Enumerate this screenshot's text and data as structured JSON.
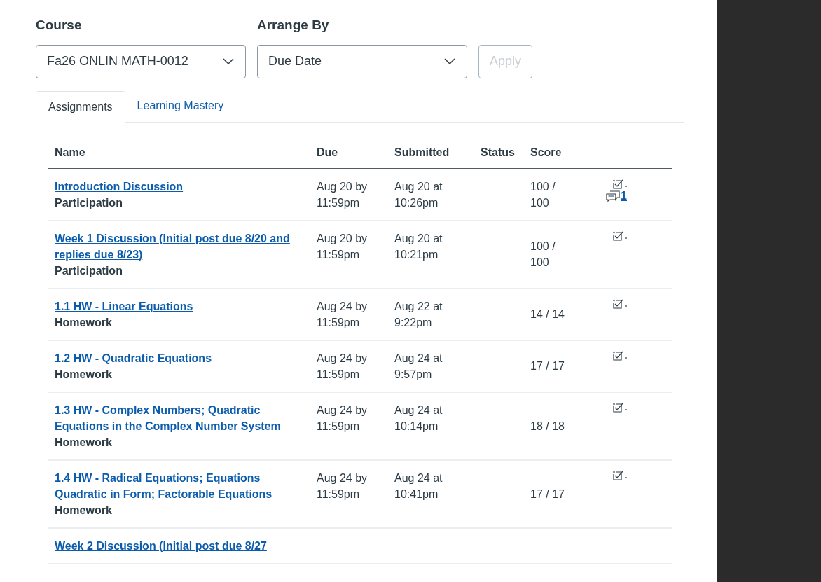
{
  "filters": {
    "course": {
      "label": "Course",
      "value": "Fa26 ONLIN MATH-0012"
    },
    "arrange": {
      "label": "Arrange By",
      "value": "Due Date"
    },
    "apply": {
      "label": "Apply",
      "disabled": true
    }
  },
  "tabs": [
    {
      "label": "Assignments",
      "selected": true
    },
    {
      "label": "Learning Mastery",
      "selected": false
    }
  ],
  "table": {
    "columns": [
      "Name",
      "Due",
      "Submitted",
      "Status",
      "Score"
    ],
    "rows": [
      {
        "name": "Introduction Discussion",
        "category": "Participation",
        "due": "Aug 20 by 11:59pm",
        "submitted": "Aug 20 at 10:26pm",
        "score": "100 / 100",
        "comments": "1"
      },
      {
        "name": "Week 1 Discussion (Initial post due 8/20 and replies due 8/23)",
        "category": "Participation",
        "due": "Aug 20 by 11:59pm",
        "submitted": "Aug 20 at 10:21pm",
        "score": "100 / 100"
      },
      {
        "name": "1.1 HW - Linear Equations",
        "category": "Homework",
        "due": "Aug 24 by 11:59pm",
        "submitted": "Aug 22 at 9:22pm",
        "score": "14 / 14"
      },
      {
        "name": "1.2 HW - Quadratic Equations",
        "category": "Homework",
        "due": "Aug 24 by 11:59pm",
        "submitted": "Aug 24 at 9:57pm",
        "score": "17 / 17"
      },
      {
        "name": "1.3 HW - Complex Numbers; Quadratic Equations in the Complex Number System",
        "category": "Homework",
        "due": "Aug 24 by 11:59pm",
        "submitted": "Aug 24 at 10:14pm",
        "score": "18 / 18"
      },
      {
        "name": "1.4 HW - Radical Equations; Equations Quadratic in Form; Factorable Equations",
        "category": "Homework",
        "due": "Aug 24 by 11:59pm",
        "submitted": "Aug 24 at 10:41pm",
        "score": "17 / 17"
      },
      {
        "name": "Week 2 Discussion (Initial post due 8/27"
      }
    ]
  }
}
